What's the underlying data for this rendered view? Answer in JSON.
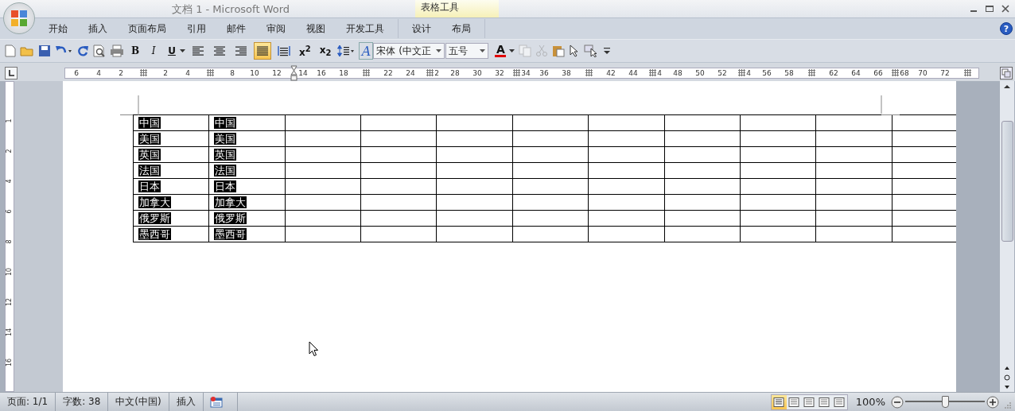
{
  "window": {
    "title": "文档 1 - Microsoft Word"
  },
  "tabs": [
    {
      "label": "开始",
      "selected": false
    },
    {
      "label": "插入",
      "selected": false
    },
    {
      "label": "页面布局",
      "selected": false
    },
    {
      "label": "引用",
      "selected": false
    },
    {
      "label": "邮件",
      "selected": false
    },
    {
      "label": "审阅",
      "selected": false
    },
    {
      "label": "视图",
      "selected": false
    },
    {
      "label": "开发工具",
      "selected": false
    }
  ],
  "contextual_group": {
    "label": "表格工具",
    "tabs": [
      {
        "label": "设计",
        "selected": false
      },
      {
        "label": "布局",
        "selected": false
      }
    ]
  },
  "help": "?",
  "toolbar": {
    "bold": "B",
    "italic": "I",
    "underline": "U",
    "alignments": [
      {
        "kind": "left",
        "selected": false
      },
      {
        "kind": "center",
        "selected": false
      },
      {
        "kind": "right",
        "selected": false
      },
      {
        "kind": "justify",
        "selected": true
      },
      {
        "kind": "distributed",
        "selected": false
      }
    ],
    "superscript": "x$^{2}$",
    "subscript": "x$_{2}$",
    "text_effects": "A",
    "font": "宋体 (中文正",
    "size": "五号",
    "font_color": {
      "label": "A",
      "color": "#e00000"
    }
  },
  "ruler": [
    {
      "kind": "number",
      "label": "6"
    },
    {
      "kind": "number",
      "label": "4"
    },
    {
      "kind": "number",
      "label": "2"
    },
    {
      "kind": "marker"
    },
    {
      "kind": "number",
      "label": "2"
    },
    {
      "kind": "number",
      "label": "4"
    },
    {
      "kind": "marker"
    },
    {
      "kind": "number",
      "label": "8"
    },
    {
      "kind": "number",
      "label": "10"
    },
    {
      "kind": "number",
      "label": "12"
    },
    {
      "kind": "indent",
      "label": "14"
    },
    {
      "kind": "number",
      "label": "16"
    },
    {
      "kind": "number",
      "label": "18"
    },
    {
      "kind": "marker"
    },
    {
      "kind": "number",
      "label": "22"
    },
    {
      "kind": "number",
      "label": "24"
    },
    {
      "kind": "marker",
      "label": "2"
    },
    {
      "kind": "number",
      "label": "28"
    },
    {
      "kind": "number",
      "label": "30"
    },
    {
      "kind": "number",
      "label": "32"
    },
    {
      "kind": "marker",
      "label": "34"
    },
    {
      "kind": "number",
      "label": "36"
    },
    {
      "kind": "number",
      "label": "38"
    },
    {
      "kind": "marker"
    },
    {
      "kind": "number",
      "label": "42"
    },
    {
      "kind": "number",
      "label": "44"
    },
    {
      "kind": "marker",
      "label": "4"
    },
    {
      "kind": "number",
      "label": "48"
    },
    {
      "kind": "number",
      "label": "50"
    },
    {
      "kind": "number",
      "label": "52"
    },
    {
      "kind": "marker",
      "label": "4"
    },
    {
      "kind": "number",
      "label": "56"
    },
    {
      "kind": "number",
      "label": "58"
    },
    {
      "kind": "marker"
    },
    {
      "kind": "number",
      "label": "62"
    },
    {
      "kind": "number",
      "label": "64"
    },
    {
      "kind": "number",
      "label": "66"
    },
    {
      "kind": "marker",
      "label": "68"
    },
    {
      "kind": "number",
      "label": "70"
    },
    {
      "kind": "number",
      "label": "72"
    },
    {
      "kind": "marker"
    }
  ],
  "vertical_ruler": [
    "1",
    "2",
    "4",
    "6",
    "8",
    "10",
    "12",
    "14",
    "16"
  ],
  "table": {
    "rows": [
      {
        "cells": [
          "中国",
          "中国"
        ],
        "selected": true
      },
      {
        "cells": [
          "美国",
          "美国"
        ],
        "selected": true
      },
      {
        "cells": [
          "英国",
          "英国"
        ],
        "selected": true
      },
      {
        "cells": [
          "法国",
          "法国"
        ],
        "selected": true
      },
      {
        "cells": [
          "日本",
          "日本"
        ],
        "selected": true
      },
      {
        "cells": [
          "加拿大",
          "加拿大"
        ],
        "selected": true
      },
      {
        "cells": [
          "俄罗斯",
          "俄罗斯"
        ],
        "selected": true
      },
      {
        "cells": [
          "墨西哥",
          "墨西哥"
        ],
        "selected": true
      }
    ]
  },
  "status_bar": {
    "page": "页面: 1/1",
    "words": "字数: 38",
    "language": "中文(中国)",
    "mode": "插入",
    "views": [
      {
        "selected": true
      },
      {
        "selected": false
      },
      {
        "selected": false
      },
      {
        "selected": false
      },
      {
        "selected": false
      }
    ],
    "zoom": "100%",
    "zoom_level": {
      "level": 0.5
    }
  }
}
